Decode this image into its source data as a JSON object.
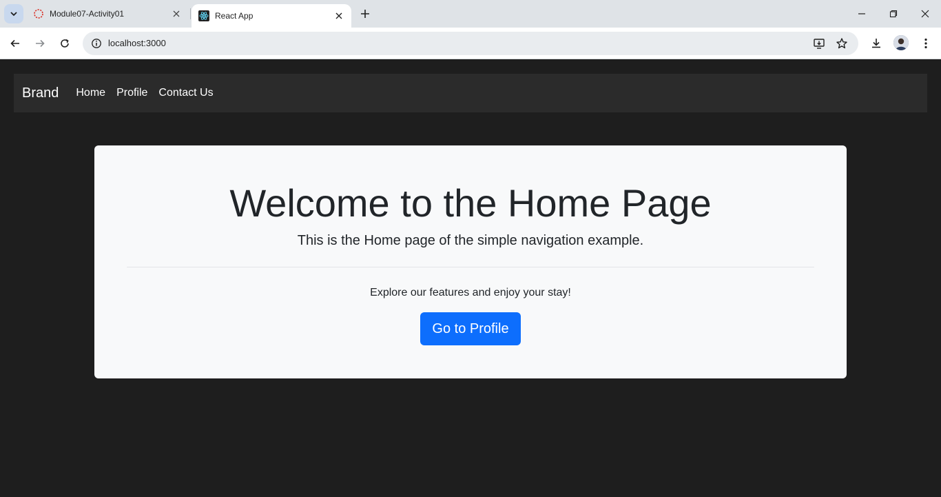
{
  "browser": {
    "tabs": [
      {
        "title": "Module07-Activity01",
        "active": false,
        "favicon": "loading-spinner-icon"
      },
      {
        "title": "React App",
        "active": true,
        "favicon": "react-logo-icon"
      }
    ],
    "url": "localhost:3000"
  },
  "app": {
    "brand": "Brand",
    "nav": [
      "Home",
      "Profile",
      "Contact Us"
    ]
  },
  "hero": {
    "title": "Welcome to the Home Page",
    "lead": "This is the Home page of the simple navigation example.",
    "subtext": "Explore our features and enjoy your stay!",
    "button_label": "Go to Profile"
  },
  "colors": {
    "page_bg": "#1e1e1e",
    "navbar_bg": "#2b2b2b",
    "card_bg": "#f8f9fa",
    "primary": "#0d6efd"
  }
}
